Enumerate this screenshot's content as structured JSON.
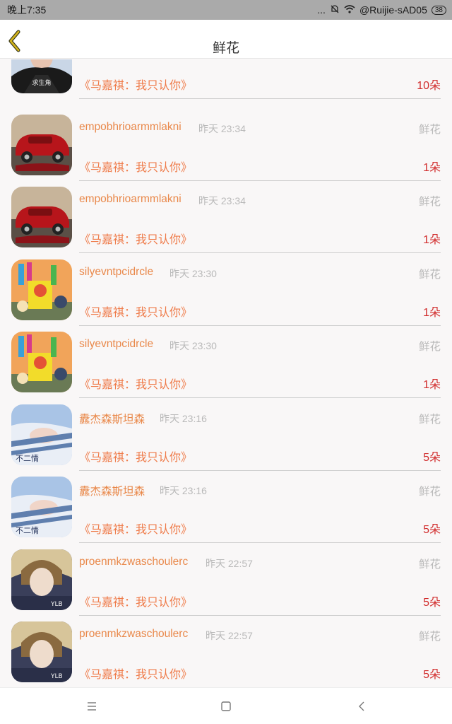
{
  "status_bar": {
    "time": "晚上7:35",
    "signal_text": "...",
    "network": "@Ruijie-sAD05",
    "battery": "38"
  },
  "header": {
    "title": "鲜花"
  },
  "items": [
    {
      "username": "",
      "time": "",
      "gift_type": "",
      "song": "《马嘉祺：我只认你》",
      "count": "10朵",
      "avatar_caption": "求生角",
      "avatar": "person-avatar"
    },
    {
      "username": "empobhrioarmmlakni",
      "time": "昨天 23:34",
      "gift_type": "鲜花",
      "song": "《马嘉祺：我只认你》",
      "count": "1朵",
      "avatar": "red-car-avatar"
    },
    {
      "username": "empobhrioarmmlakni",
      "time": "昨天 23:34",
      "gift_type": "鲜花",
      "song": "《马嘉祺：我只认你》",
      "count": "1朵",
      "avatar": "red-car-avatar"
    },
    {
      "username": "silyevntpcidrcle",
      "time": "昨天 23:30",
      "gift_type": "鲜花",
      "song": "《马嘉祺：我只认你》",
      "count": "1朵",
      "avatar": "toy-avatar"
    },
    {
      "username": "silyevntpcidrcle",
      "time": "昨天 23:30",
      "gift_type": "鲜花",
      "song": "《马嘉祺：我只认你》",
      "count": "1朵",
      "avatar": "toy-avatar"
    },
    {
      "username": "纛杰森斯坦森",
      "time": "昨天 23:16",
      "gift_type": "鲜花",
      "song": "《马嘉祺：我只认你》",
      "count": "5朵",
      "avatar_caption": "不二情",
      "avatar": "sleeping-avatar"
    },
    {
      "username": "纛杰森斯坦森",
      "time": "昨天 23:16",
      "gift_type": "鲜花",
      "song": "《马嘉祺：我只认你》",
      "count": "5朵",
      "avatar_caption": "不二情",
      "avatar": "sleeping-avatar"
    },
    {
      "username": "proenmkzwaschoulerc",
      "time": "昨天 22:57",
      "gift_type": "鲜花",
      "song": "《马嘉祺：我只认你》",
      "count": "5朵",
      "avatar_caption": "YLB",
      "avatar": "portrait-avatar"
    },
    {
      "username": "proenmkzwaschoulerc",
      "time": "昨天 22:57",
      "gift_type": "鲜花",
      "song": "《马嘉祺：我只认你》",
      "count": "5朵",
      "avatar_caption": "YLB",
      "avatar": "portrait-avatar"
    }
  ],
  "bottom_nav": {
    "icons": [
      "menu-icon",
      "home-square-icon",
      "back-arrow-icon"
    ]
  },
  "colors": {
    "username": "#e9884a",
    "song": "#ef7a48",
    "count": "#d12c2c",
    "muted": "#b9b9b9",
    "back_arrow": "#d4b41a"
  }
}
